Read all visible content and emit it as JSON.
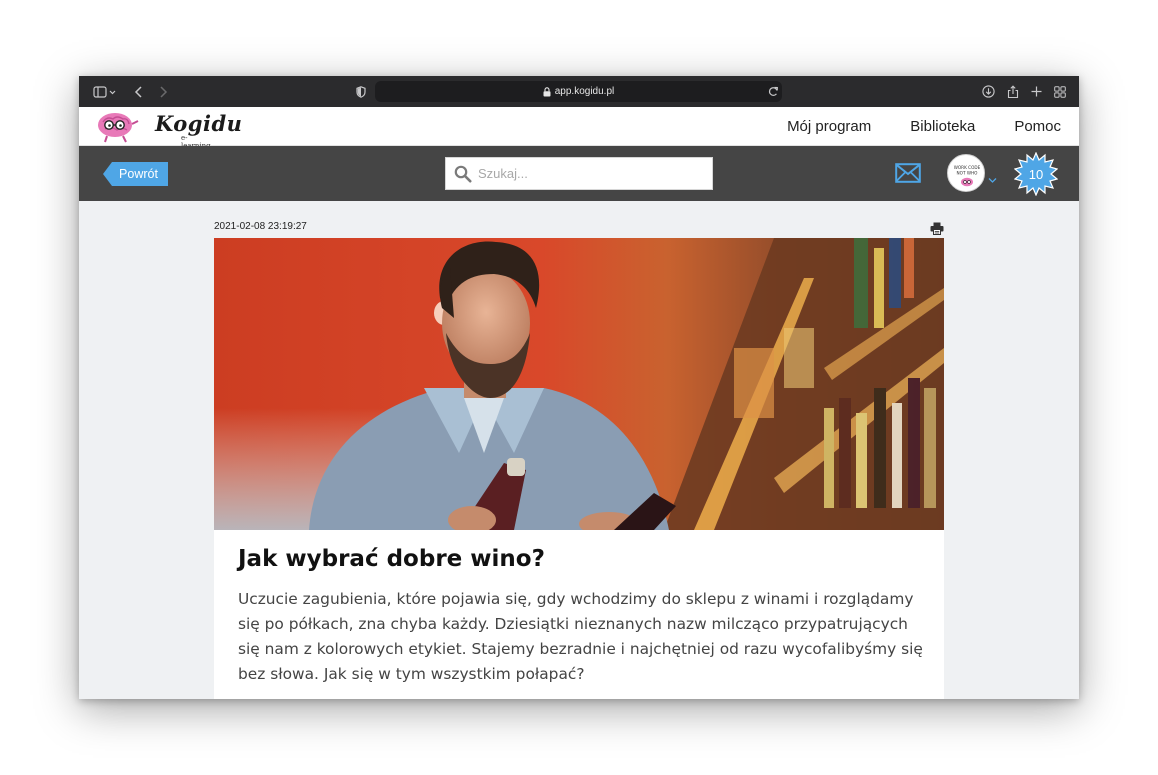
{
  "browser": {
    "url": "app.kogidu.pl"
  },
  "brand": {
    "name": "Kogidu",
    "tagline": "e-learning",
    "avatar_text": "WORK CODE NOT WHO"
  },
  "nav": {
    "items": [
      {
        "label": "Mój program"
      },
      {
        "label": "Biblioteka"
      },
      {
        "label": "Pomoc"
      }
    ]
  },
  "toolbar": {
    "back_label": "Powrót",
    "search_placeholder": "Szukaj...",
    "points": "10"
  },
  "article": {
    "date": "2021-02-08 23:19:27",
    "title": "Jak wybrać dobre wino?",
    "lead": "Uczucie zagubienia, które pojawia się, gdy wchodzimy do sklepu z winami i rozglądamy się po półkach, zna chyba każdy. Dziesiątki nieznanych nazw milcząco przypatrujących się nam z kolorowych etykiet. Stajemy bezradnie i najchętniej od razu wycofalibyśmy się bez słowa. Jak się w tym wszystkim połapać?"
  },
  "colors": {
    "accent_blue": "#4fa6e6",
    "toolbar_dark": "#454545",
    "brand_pink": "#e879b8"
  },
  "icons": {
    "sidebar": "sidebar-icon",
    "back": "chevron-left-icon",
    "forward": "chevron-right-icon",
    "privacy": "shield-icon",
    "lock": "lock-icon",
    "reload": "reload-icon",
    "download": "download-icon",
    "share": "share-icon",
    "new_tab": "plus-icon",
    "tabs": "tab-overview-icon",
    "search": "search-icon",
    "mail": "mail-icon",
    "print": "print-icon"
  }
}
